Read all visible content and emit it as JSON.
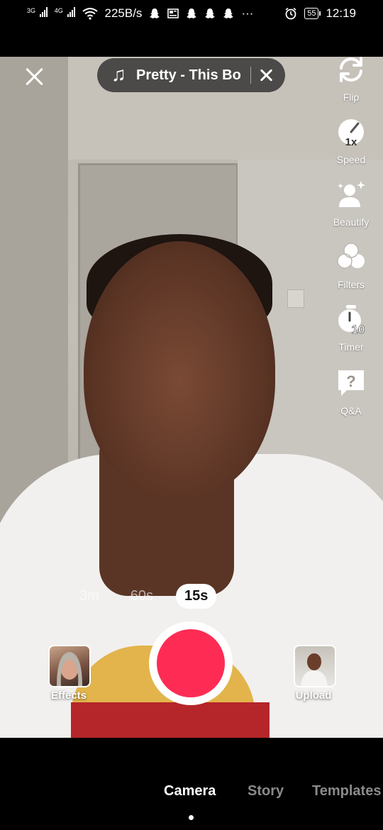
{
  "status_bar": {
    "network_1": "3G",
    "network_2": "4G",
    "speed": "225B/s",
    "more": "···",
    "battery": "55",
    "time": "12:19"
  },
  "top": {
    "sound_title": "Pretty - This Bo"
  },
  "side_tools": [
    {
      "label": "Flip",
      "icon": "flip-camera-icon"
    },
    {
      "label": "Speed",
      "icon": "speed-icon",
      "badge": "1x"
    },
    {
      "label": "Beautify",
      "icon": "beautify-icon"
    },
    {
      "label": "Filters",
      "icon": "filters-icon"
    },
    {
      "label": "Timer",
      "icon": "timer-icon",
      "badge": "10"
    },
    {
      "label": "Q&A",
      "icon": "qa-icon",
      "glyph": "?"
    }
  ],
  "durations": [
    "3m",
    "60s",
    "15s"
  ],
  "active_duration": "15s",
  "effects_label": "Effects",
  "upload_label": "Upload",
  "bottom_tabs": [
    "Camera",
    "Story",
    "Templates"
  ],
  "active_tab": "Camera",
  "colors": {
    "record": "#fe2c55",
    "background": "#000000"
  }
}
